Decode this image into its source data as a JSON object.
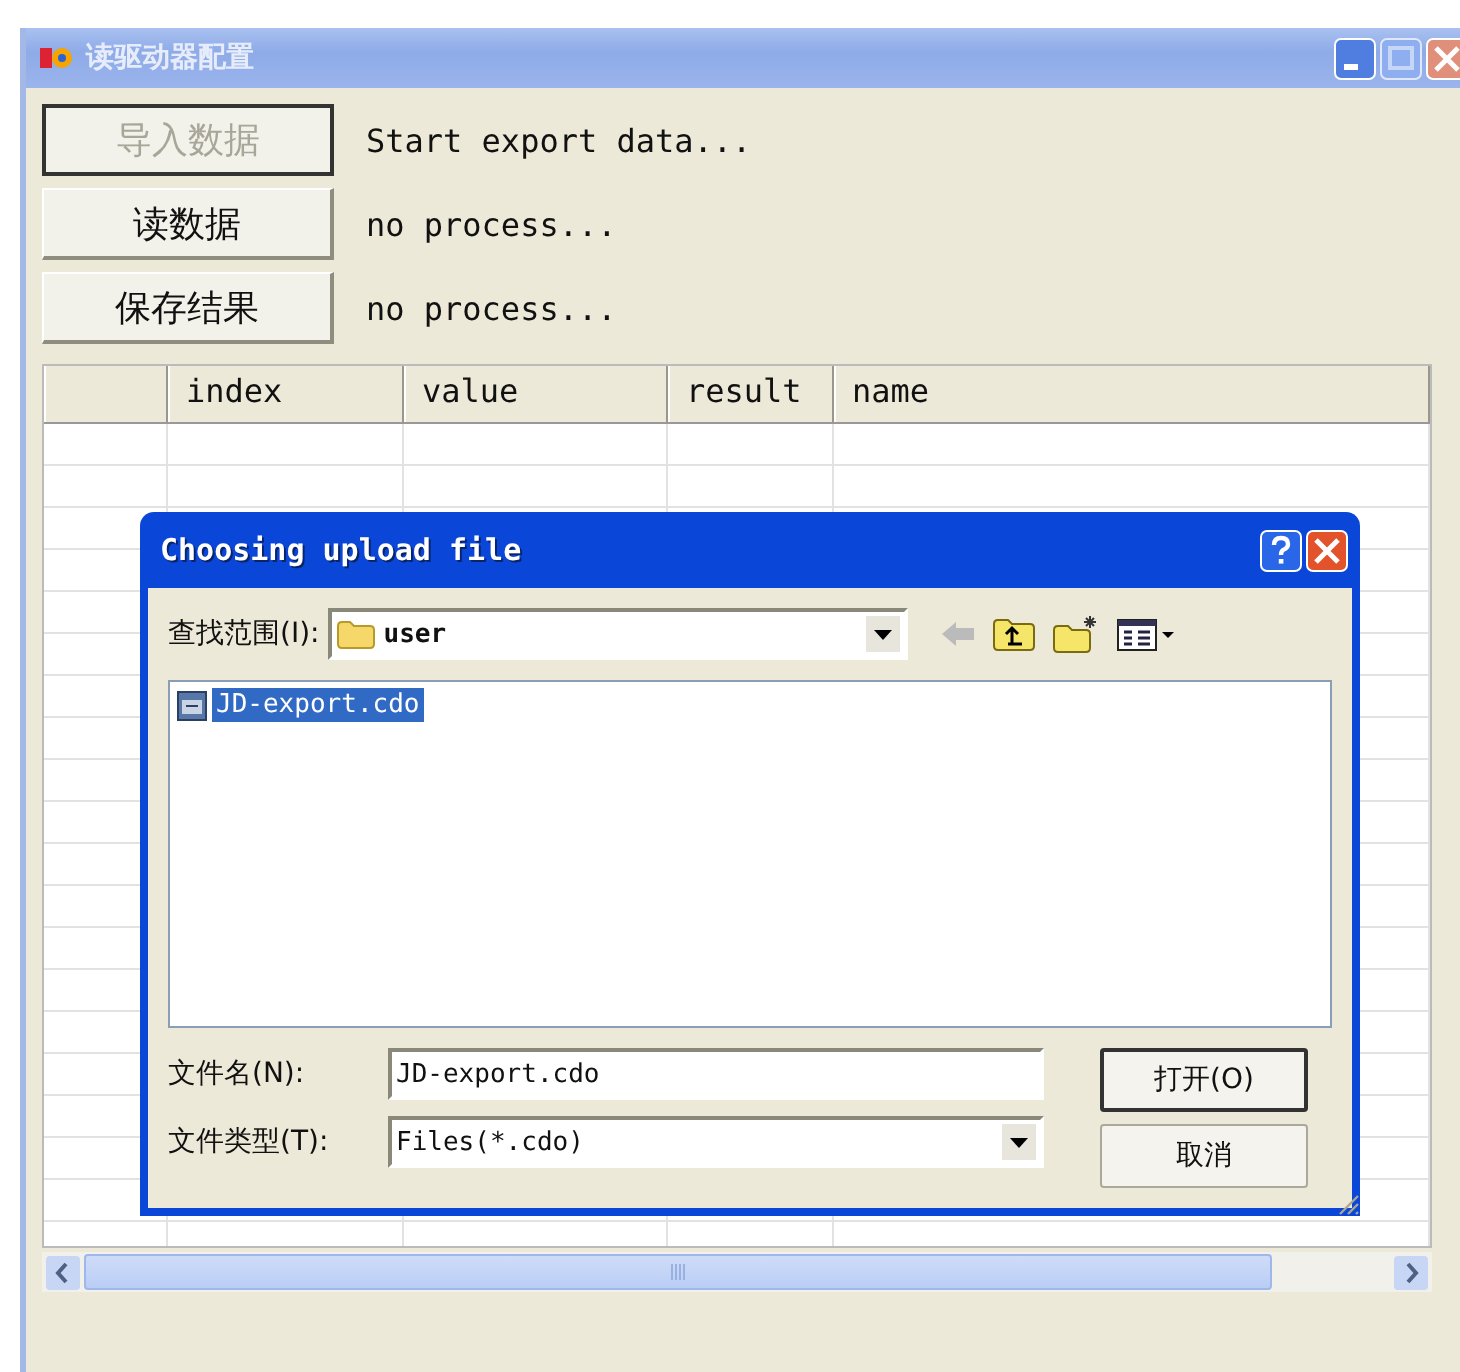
{
  "window": {
    "title": "读驱动器配置",
    "active": false
  },
  "actions": [
    {
      "label": "导入数据",
      "disabled": true,
      "status": "Start export data..."
    },
    {
      "label": "读数据",
      "disabled": false,
      "status": "no process..."
    },
    {
      "label": "保存结果",
      "disabled": false,
      "status": "no process..."
    }
  ],
  "table": {
    "columns": [
      "",
      "index",
      "value",
      "result",
      "name"
    ]
  },
  "dialog": {
    "title": "Choosing upload file",
    "look_in_label": "查找范围(I):",
    "look_in": "user",
    "files": [
      {
        "name": "JD-export.cdo",
        "selected": true
      }
    ],
    "file_name_label": "文件名(N):",
    "file_name": "JD-export.cdo",
    "file_type_label": "文件类型(T):",
    "file_type": "Files(*.cdo)",
    "buttons": [
      {
        "label": "打开(O)",
        "default": true
      },
      {
        "label": "取消",
        "default": false
      }
    ]
  }
}
